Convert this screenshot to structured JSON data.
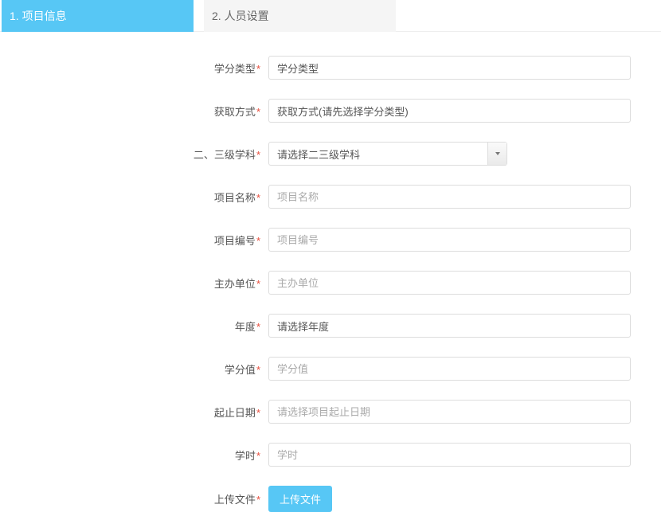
{
  "tabs": [
    {
      "label": "1. 项目信息",
      "active": true
    },
    {
      "label": "2. 人员设置",
      "active": false
    }
  ],
  "form": {
    "creditType": {
      "label": "学分类型",
      "value": "学分类型"
    },
    "obtainMethod": {
      "label": "获取方式",
      "value": "获取方式(请先选择学分类型)"
    },
    "subject": {
      "label": "二、三级学科",
      "value": "请选择二三级学科"
    },
    "projectName": {
      "label": "项目名称",
      "placeholder": "项目名称"
    },
    "projectNo": {
      "label": "项目编号",
      "placeholder": "项目编号"
    },
    "hostUnit": {
      "label": "主办单位",
      "placeholder": "主办单位"
    },
    "year": {
      "label": "年度",
      "value": "请选择年度"
    },
    "creditValue": {
      "label": "学分值",
      "placeholder": "学分值"
    },
    "dateRange": {
      "label": "起止日期",
      "placeholder": "请选择项目起止日期"
    },
    "classHour": {
      "label": "学时",
      "placeholder": "学时"
    },
    "upload": {
      "label": "上传文件",
      "button": "上传文件"
    }
  }
}
